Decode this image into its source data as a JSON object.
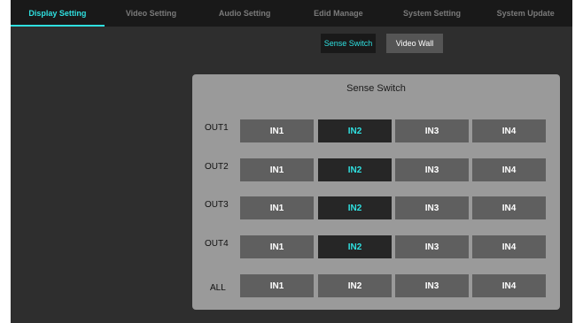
{
  "nav": {
    "tabs": [
      {
        "label": "Display Setting"
      },
      {
        "label": "Video Setting"
      },
      {
        "label": "Audio Setting"
      },
      {
        "label": "Edid Manage"
      },
      {
        "label": "System Setting"
      },
      {
        "label": "System Update"
      }
    ],
    "active_tab": "Display Setting"
  },
  "subnav": {
    "sense_switch": "Sense Switch",
    "video_wall": "Video Wall",
    "active": "Sense Switch"
  },
  "panel": {
    "title": "Sense Switch",
    "input_labels": [
      "IN1",
      "IN2",
      "IN3",
      "IN4"
    ],
    "rows": [
      {
        "label": "OUT1",
        "selected": "IN2"
      },
      {
        "label": "OUT2",
        "selected": "IN2"
      },
      {
        "label": "OUT3",
        "selected": "IN2"
      },
      {
        "label": "OUT4",
        "selected": "IN2"
      },
      {
        "label": "ALL",
        "selected": null
      }
    ]
  },
  "colors": {
    "accent": "#2fe0e0",
    "nav_background": "#191919",
    "app_background": "#2e2e2e",
    "panel_background": "#9a9a9a",
    "button_background": "#5f5f5f",
    "selected_button_background": "#262626"
  }
}
